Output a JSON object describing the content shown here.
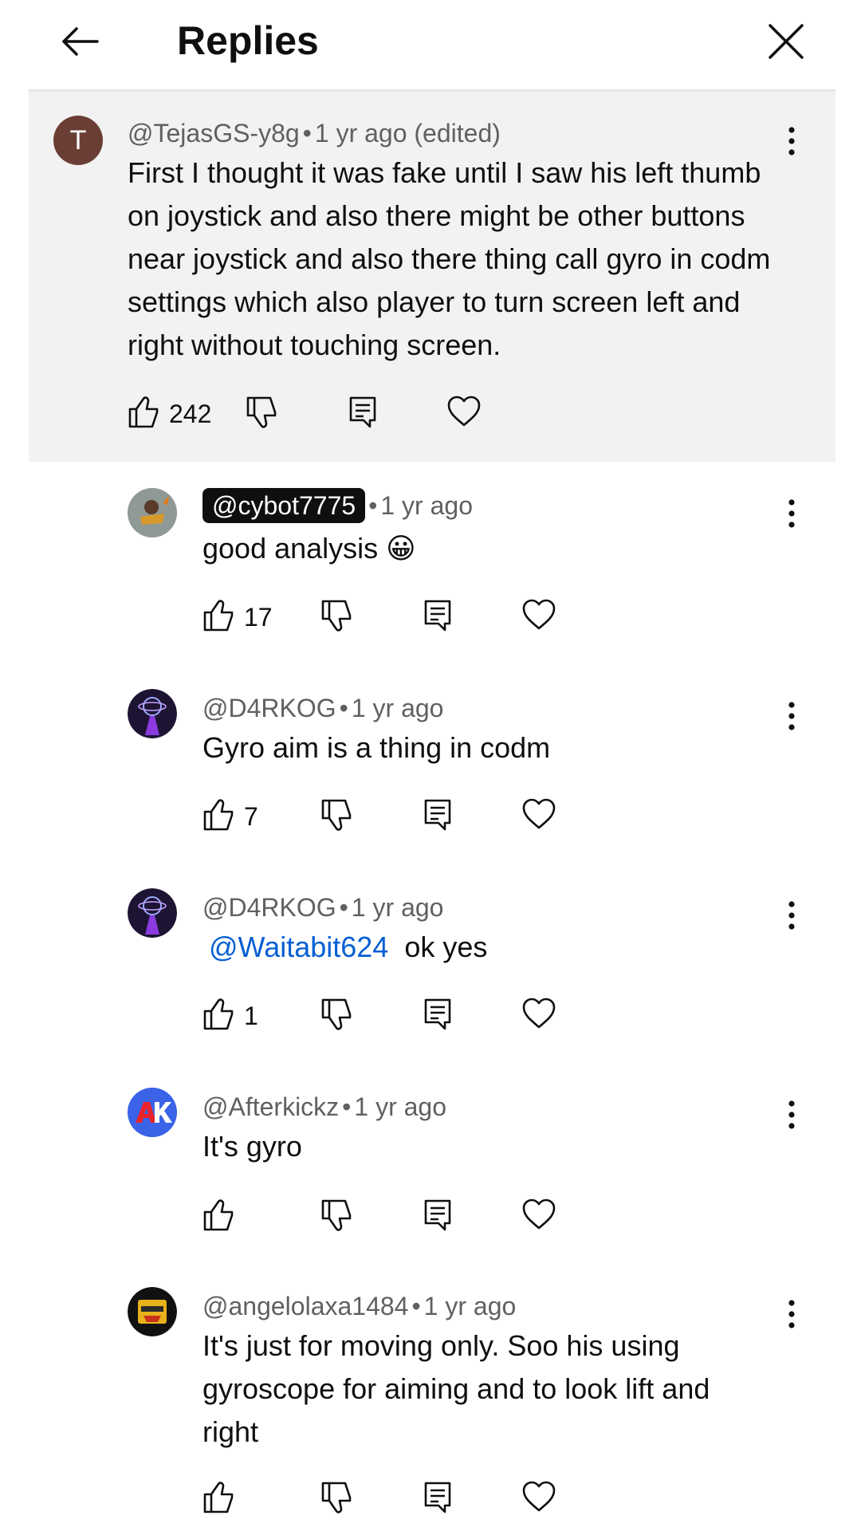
{
  "header": {
    "title": "Replies"
  },
  "parent_comment": {
    "avatar_letter": "T",
    "author": "@TejasGS-y8g",
    "time": "1 yr ago (edited)",
    "text": "First I thought it was fake until I saw his left thumb on joystick and also there might be other buttons near joystick and also there thing call gyro in codm settings which also player to turn screen left and right without touching screen.",
    "likes": "242"
  },
  "replies": [
    {
      "author": "@cybot7775",
      "time": "1 yr ago",
      "text": "good analysis 😀",
      "likes": "17"
    },
    {
      "author": "@D4RKOG",
      "time": "1 yr ago",
      "text": "Gyro aim is a thing in codm",
      "likes": "7"
    },
    {
      "author": "@D4RKOG",
      "time": "1 yr ago",
      "mention": "@Waitabit624",
      "text": "ok yes",
      "likes": "1"
    },
    {
      "author": "@Afterkickz",
      "time": "1 yr ago",
      "text": "It's gyro",
      "likes": ""
    },
    {
      "author": "@angelolaxa1484",
      "time": "1 yr ago",
      "text": "It's just for moving only. Soo his using gyroscope for aiming and to look lift and right",
      "likes": ""
    }
  ],
  "icons": [
    "back-arrow-icon",
    "close-icon",
    "more-vert-icon",
    "thumb-up-icon",
    "thumb-down-icon",
    "reply-icon",
    "heart-icon"
  ],
  "colors": {
    "mention": "#065fd4",
    "meta": "#606060",
    "highlight_bg": "#f2f2f2"
  }
}
